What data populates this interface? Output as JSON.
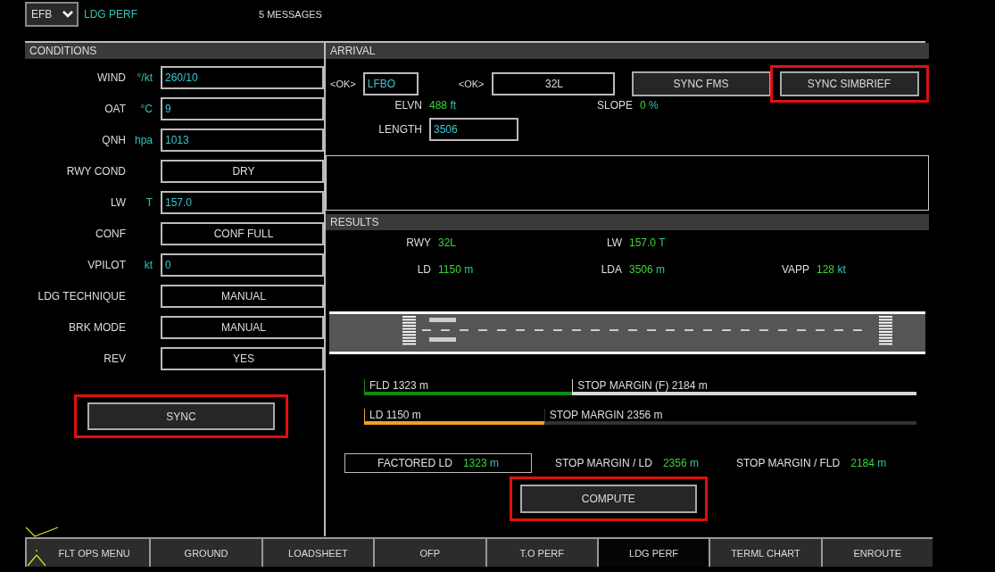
{
  "header": {
    "dropdown": "EFB",
    "page": "LDG PERF",
    "messages": "5 MESSAGES"
  },
  "conditions": {
    "title": "CONDITIONS",
    "rows": [
      {
        "kind": "input",
        "label": "WIND",
        "unit": "°/kt",
        "value": "260/10"
      },
      {
        "kind": "input",
        "label": "OAT",
        "unit": "°C",
        "value": "9"
      },
      {
        "kind": "input",
        "label": "QNH",
        "unit": "hpa",
        "value": "1013"
      },
      {
        "kind": "select",
        "label": "RWY COND",
        "value": "DRY"
      },
      {
        "kind": "input",
        "label": "LW",
        "unit": "T",
        "value": "157.0"
      },
      {
        "kind": "select",
        "label": "CONF",
        "value": "CONF FULL"
      },
      {
        "kind": "input",
        "label": "VPILOT",
        "unit": "kt",
        "value": "0"
      },
      {
        "kind": "select",
        "label": "LDG TECHNIQUE",
        "value": "MANUAL"
      },
      {
        "kind": "select",
        "label": "BRK MODE",
        "value": "MANUAL"
      },
      {
        "kind": "select",
        "label": "REV",
        "value": "YES"
      }
    ],
    "sync": {
      "label": "SYNC",
      "highlighted": true
    }
  },
  "arrival": {
    "title": "ARRIVAL",
    "airport_ok": "<OK>",
    "airport": "LFBO",
    "runway_ok": "<OK>",
    "runway": "32L",
    "buttons": [
      {
        "label": "SYNC FMS",
        "highlighted": false
      },
      {
        "label": "SYNC SIMBRIEF",
        "highlighted": true
      }
    ],
    "elvn": {
      "label": "ELVN",
      "value": "488",
      "unit": "ft"
    },
    "slope": {
      "label": "SLOPE",
      "value": "0",
      "unit": "%"
    },
    "length": {
      "label": "LENGTH",
      "value": "3506"
    }
  },
  "results": {
    "title": "RESULTS",
    "rows": [
      [
        {
          "label": "RWY",
          "value": "32L"
        },
        {
          "label": "LW",
          "value": "157.0",
          "unit": "T"
        }
      ],
      [
        {
          "label": "LD",
          "value": "1150",
          "unit": "m"
        },
        {
          "label": "LDA",
          "value": "3506",
          "unit": "m"
        },
        {
          "label": "VAPP",
          "value": "128",
          "unit": "kt"
        }
      ]
    ],
    "bars": [
      {
        "segments": [
          {
            "label": "FLD 1323 m",
            "level": 0.377,
            "color": "#138a13"
          },
          {
            "label": "STOP MARGIN (F) 2184 m",
            "color": "#d8d8d8"
          }
        ]
      },
      {
        "segments": [
          {
            "label": "LD 1150 m",
            "level": 0.326,
            "color": "#f5a020"
          },
          {
            "label": "STOP MARGIN 2356 m",
            "color": "#333333"
          }
        ]
      }
    ],
    "factored": {
      "label": "FACTORED LD",
      "value": "1323",
      "unit": "m"
    },
    "margins": [
      {
        "label": "STOP MARGIN / LD",
        "value": "2356",
        "unit": "m"
      },
      {
        "label": "STOP MARGIN / FLD",
        "value": "2184",
        "unit": "m"
      }
    ],
    "compute": {
      "label": "COMPUTE",
      "highlighted": true
    }
  },
  "tabs": [
    {
      "label": "FLT OPS MENU",
      "selected": false
    },
    {
      "label": "GROUND",
      "selected": false
    },
    {
      "label": "LOADSHEET",
      "selected": false
    },
    {
      "label": "OFP",
      "selected": false
    },
    {
      "label": "T.O PERF",
      "selected": false
    },
    {
      "label": "LDG PERF",
      "selected": true
    },
    {
      "label": "TERML CHART",
      "selected": false
    },
    {
      "label": "ENROUTE",
      "selected": false
    }
  ]
}
